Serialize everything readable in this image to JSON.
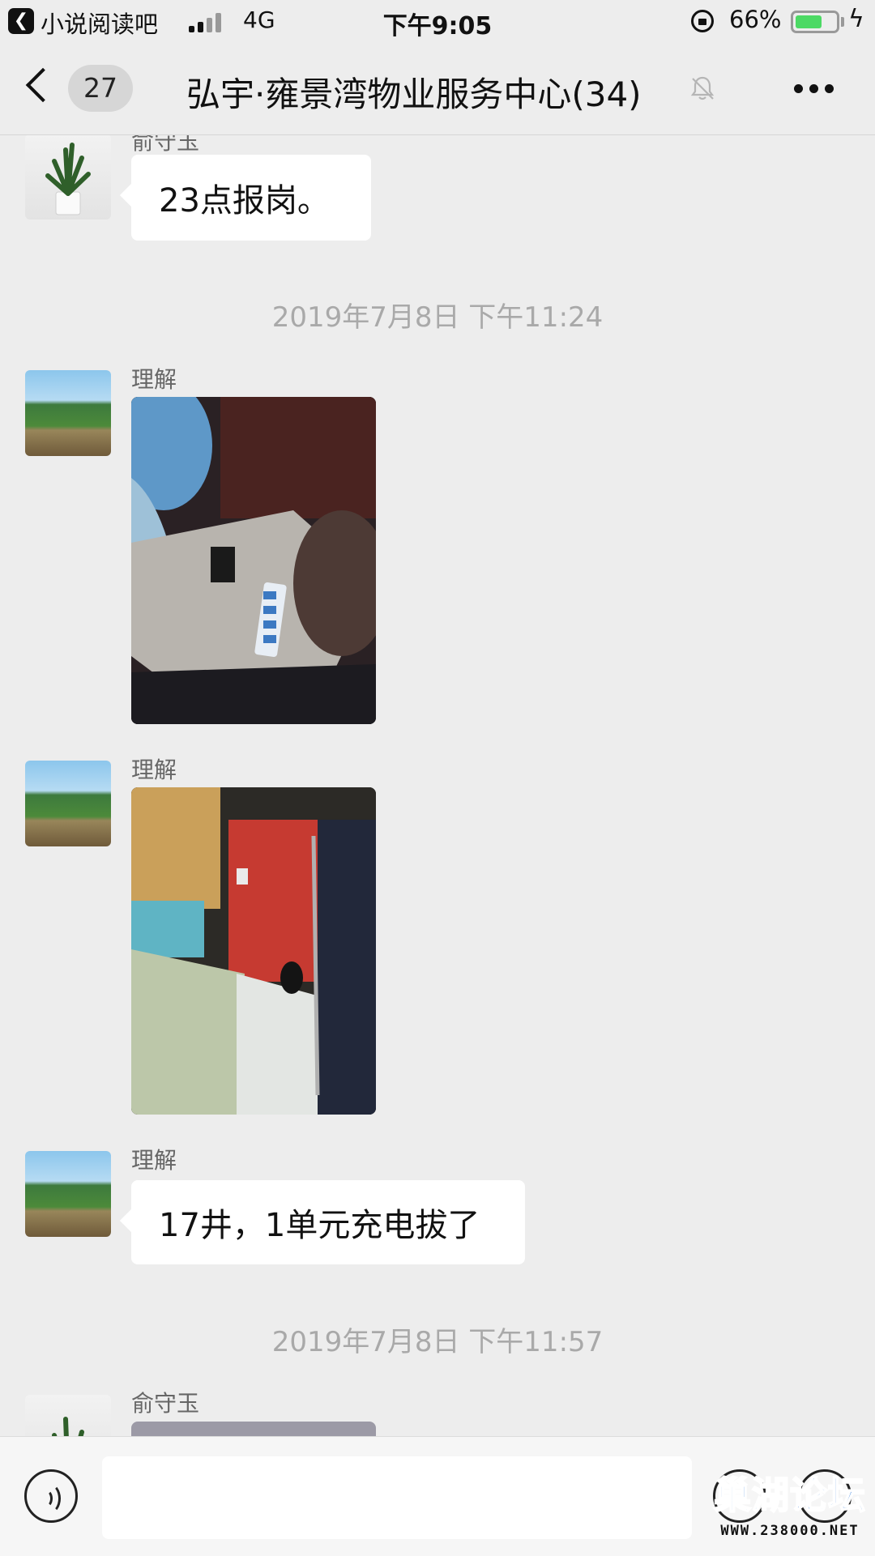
{
  "status_bar": {
    "back_app": "小说阅读吧",
    "network": "4G",
    "time": "下午9:05",
    "battery_percent_text": "66%",
    "battery_level": 0.66,
    "icons": [
      "back-to-app-icon",
      "signal-icon",
      "rotation-lock-icon",
      "battery-icon",
      "charging-icon"
    ]
  },
  "nav": {
    "unread_count": "27",
    "title": "弘宇·雍景湾物业服务中心(34)",
    "icons": [
      "back-chevron-icon",
      "mute-bell-icon",
      "more-icon"
    ]
  },
  "messages": [
    {
      "type": "text",
      "sender": "俞守玉",
      "text": "23点报岗。"
    },
    {
      "type": "timestamp",
      "text": "2019年7月8日 下午11:24"
    },
    {
      "type": "image",
      "sender": "理解"
    },
    {
      "type": "image",
      "sender": "理解"
    },
    {
      "type": "text",
      "sender": "理解",
      "text": "17井，1单元充电拔了"
    },
    {
      "type": "timestamp",
      "text": "2019年7月8日 下午11:57"
    },
    {
      "type": "image",
      "sender": "俞守玉"
    }
  ],
  "input_bar": {
    "placeholder": "",
    "icons": [
      "voice-icon",
      "emoji-icon",
      "plus-icon"
    ]
  },
  "watermark": {
    "title": "巢湖论坛",
    "url": "WWW.238000.NET"
  },
  "colors": {
    "background": "#ededed",
    "bubble": "#ffffff",
    "battery": "#4cd964",
    "watermark_blue": "#1d6fd8"
  }
}
